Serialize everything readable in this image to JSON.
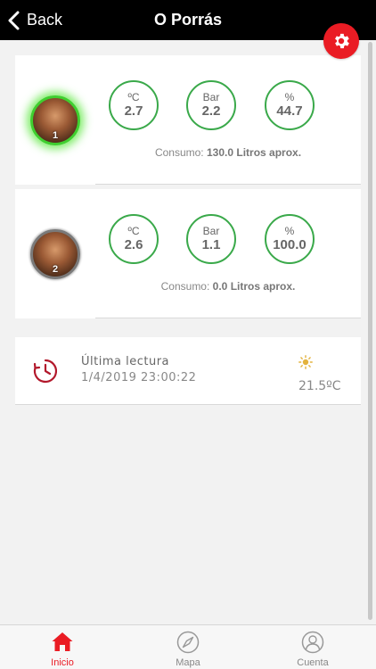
{
  "header": {
    "back_label": "Back",
    "title": "O Porrás"
  },
  "tanks": [
    {
      "number": "1",
      "status": "active",
      "gauges": [
        {
          "unit": "ºC",
          "value": "2.7"
        },
        {
          "unit": "Bar",
          "value": "2.2"
        },
        {
          "unit": "%",
          "value": "44.7"
        }
      ],
      "consumo_label": "Consumo:",
      "consumo_value": "130.0 Litros aprox."
    },
    {
      "number": "2",
      "status": "inactive",
      "gauges": [
        {
          "unit": "ºC",
          "value": "2.6"
        },
        {
          "unit": "Bar",
          "value": "1.1"
        },
        {
          "unit": "%",
          "value": "100.0"
        }
      ],
      "consumo_label": "Consumo:",
      "consumo_value": "0.0 Litros aprox."
    }
  ],
  "reading": {
    "label": "Última lectura",
    "datetime": "1/4/2019 23:00:22",
    "temperature": "21.5ºC"
  },
  "tabbar": {
    "inicio": "Inicio",
    "mapa": "Mapa",
    "cuenta": "Cuenta"
  },
  "colors": {
    "accent": "#ea1c24",
    "gauge_border": "#3aa94a",
    "active_glow": "#3fcf2f",
    "sun": "#e3b23c",
    "clock": "#b2182b"
  }
}
